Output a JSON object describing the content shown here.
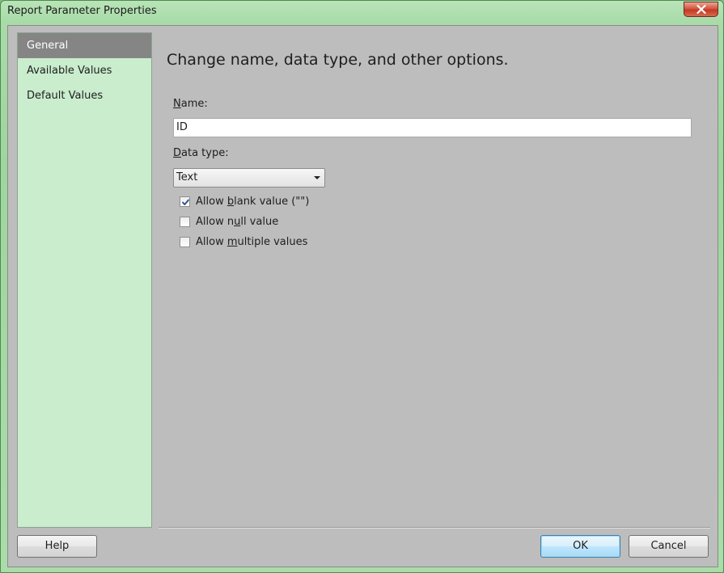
{
  "window": {
    "title": "Report Parameter Properties"
  },
  "nav": {
    "items": [
      {
        "label": "General",
        "selected": true
      },
      {
        "label": "Available Values",
        "selected": false
      },
      {
        "label": "Default Values",
        "selected": false
      }
    ]
  },
  "main": {
    "heading": "Change name, data type, and other options.",
    "name_label_access": "N",
    "name_label_rest": "ame:",
    "name_value": "ID",
    "datatype_label_access": "D",
    "datatype_label_rest": "ata type:",
    "datatype_value": "Text",
    "checkboxes": [
      {
        "pre": "Allow ",
        "access": "b",
        "post": "lank value (\"\")",
        "checked": true
      },
      {
        "pre": "Allow n",
        "access": "u",
        "post": "ll value",
        "checked": false
      },
      {
        "pre": "Allow ",
        "access": "m",
        "post": "ultiple values",
        "checked": false
      }
    ]
  },
  "footer": {
    "help_label": "Help",
    "ok_label": "OK",
    "cancel_label": "Cancel"
  },
  "icons": {
    "close": "close-icon",
    "checkmark": "checkmark-icon",
    "dropdown": "chevron-down-icon"
  }
}
